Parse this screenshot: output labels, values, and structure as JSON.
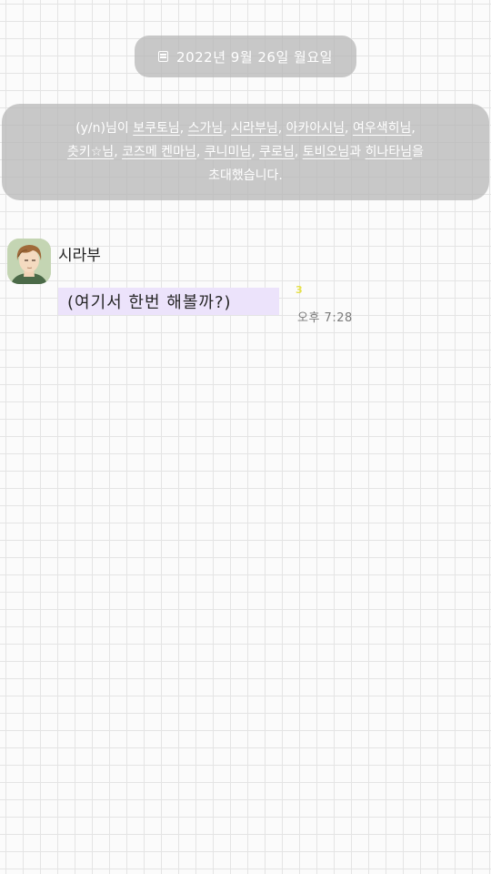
{
  "date_header": {
    "icon": "calendar-icon",
    "text": "2022년 9월 26일 월요일"
  },
  "system_notice": {
    "inviter": "(y/n)님이 ",
    "invitees": [
      {
        "name": "보쿠토님",
        "sep": ", "
      },
      {
        "name": "스가님",
        "sep": ", "
      },
      {
        "name": "시라부님",
        "sep": ", "
      },
      {
        "name": "아카아시님",
        "sep": ", "
      },
      {
        "name": "여우색히님",
        "sep": ", "
      },
      {
        "name": "츳키☆님",
        "sep": ", "
      },
      {
        "name": "코즈메 켄마님",
        "sep": ", "
      },
      {
        "name": "쿠니미님",
        "sep": ", "
      },
      {
        "name": "쿠로님",
        "sep": ", "
      },
      {
        "name": "토비오님",
        "sep": "과 "
      },
      {
        "name": "히나타님",
        "sep": "을"
      }
    ],
    "suffix": "초대했습니다."
  },
  "message": {
    "sender": "시라부",
    "text": "(여기서 한번 해볼까?)",
    "unread_count": "3",
    "time": "오후 7:28",
    "bubble_color": "#ece3fb"
  },
  "colors": {
    "notice_bg": "#b4b4b4",
    "grid_line": "#e4e4e4",
    "unread": "#e5e047"
  }
}
